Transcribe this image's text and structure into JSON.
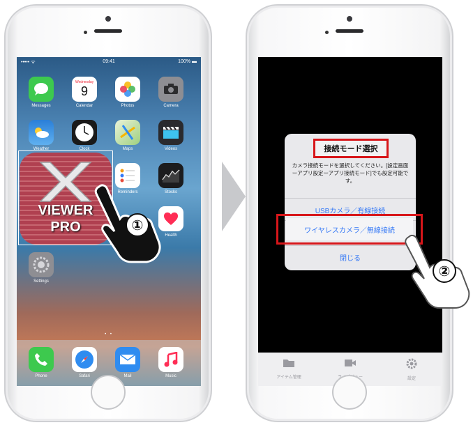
{
  "left_phone": {
    "status": {
      "carrier": "••••• ᯤ",
      "time": "09:41",
      "battery": "100% ▬"
    },
    "apps": [
      {
        "name": "Messages",
        "color": "#3dc94e",
        "glyph": "💬"
      },
      {
        "name": "Calendar",
        "color": "#ffffff",
        "glyph": "9",
        "sub": "Wednesday"
      },
      {
        "name": "Photos",
        "color": "#ffffff",
        "glyph": "✿"
      },
      {
        "name": "Camera",
        "color": "#8e8e93",
        "glyph": "◉"
      },
      {
        "name": "Weather",
        "color": "#3a8fe0",
        "glyph": "☁"
      },
      {
        "name": "Clock",
        "color": "#1a1a1a",
        "glyph": "◷"
      },
      {
        "name": "Maps",
        "color": "#4cc36a",
        "glyph": "➚"
      },
      {
        "name": "Videos",
        "color": "#2a2a2e",
        "glyph": "▶"
      },
      {
        "name": "Reminders",
        "color": "#ffffff",
        "glyph": "☰"
      },
      {
        "name": "Stocks",
        "color": "#1c1c1e",
        "glyph": "∿"
      },
      {
        "name": "Health",
        "color": "#ffffff",
        "glyph": "❤"
      },
      {
        "name": "Settings",
        "color": "#8e8e93",
        "glyph": "⚙"
      }
    ],
    "dock": [
      {
        "name": "Phone",
        "color": "#3dc94e",
        "glyph": "✆"
      },
      {
        "name": "Safari",
        "color": "#2f8cf0",
        "glyph": "⊘"
      },
      {
        "name": "Mail",
        "color": "#2f8cf0",
        "glyph": "✉"
      },
      {
        "name": "Music",
        "color": "#ffffff",
        "glyph": "♫"
      }
    ],
    "viewer_pro": {
      "line1": "VIEWER",
      "line2": "PRO"
    },
    "step_badge": "①"
  },
  "right_phone": {
    "alert": {
      "title": "接続モード選択",
      "message": "カメラ接続モードを選択してください。[設定画面ーアプリ設定ーアプリ接続モード]でも設定可能です。",
      "usb_button": "USBカメラ／有線接続",
      "wireless_button": "ワイヤレスカメラ／無線接続",
      "close_button": "閉じる"
    },
    "tabs": [
      {
        "label": "アイテム管理",
        "glyph": "▬"
      },
      {
        "label": "ライブビュー",
        "glyph": "■"
      },
      {
        "label": "設定",
        "glyph": "⚙"
      }
    ],
    "step_badge": "②"
  },
  "colors": {
    "highlight_red": "#d7161a",
    "ios_blue": "#3478f6"
  }
}
